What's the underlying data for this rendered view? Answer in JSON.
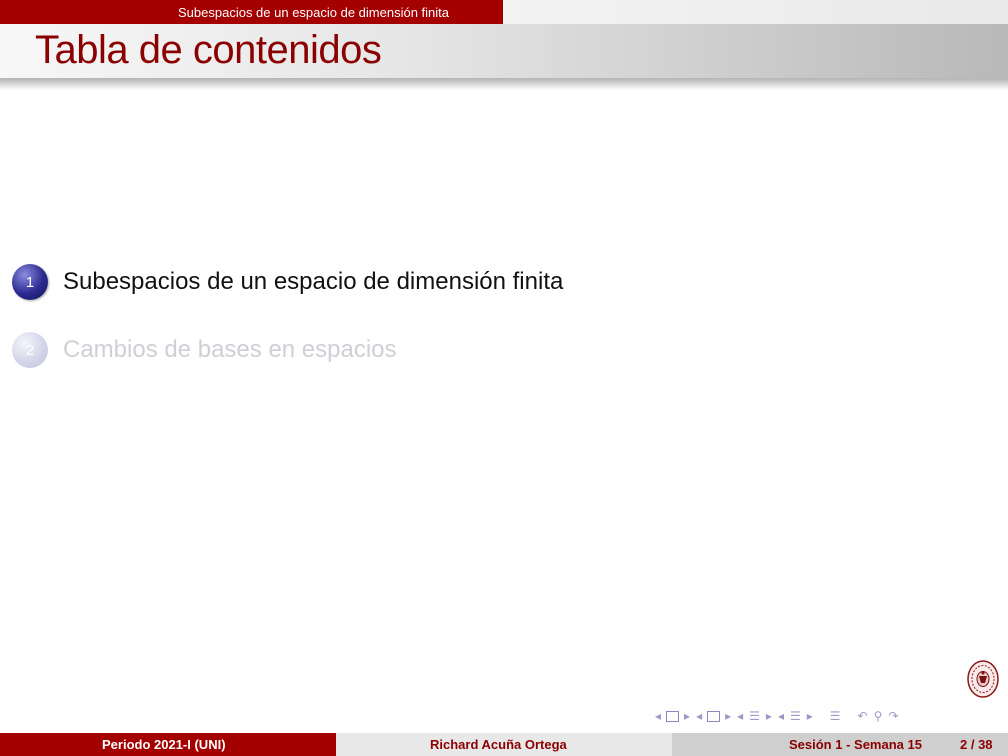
{
  "header": {
    "section_label": "Subespacios de un espacio de dimensión finita"
  },
  "frame": {
    "title": "Tabla de contenidos"
  },
  "toc": [
    {
      "number": "1",
      "label": "Subespacios de un espacio de dimensión finita",
      "state": "active"
    },
    {
      "number": "2",
      "label": "Cambios de bases en espacios",
      "state": "inactive"
    }
  ],
  "navigation": {
    "icons": [
      "arrow-left-icon",
      "frame-icon",
      "arrow-right-icon",
      "subsection-icon",
      "section-icon",
      "zoom-icon",
      "back-icon"
    ]
  },
  "footer": {
    "left": "Periodo 2021-I  (UNI)",
    "center": "Richard Acuña Ortega",
    "right": "Sesión 1 - Semana 15",
    "page": "2 / 38"
  },
  "colors": {
    "accent": "#a50000",
    "title": "#8b0000",
    "ball_active": "#2a2a90"
  }
}
